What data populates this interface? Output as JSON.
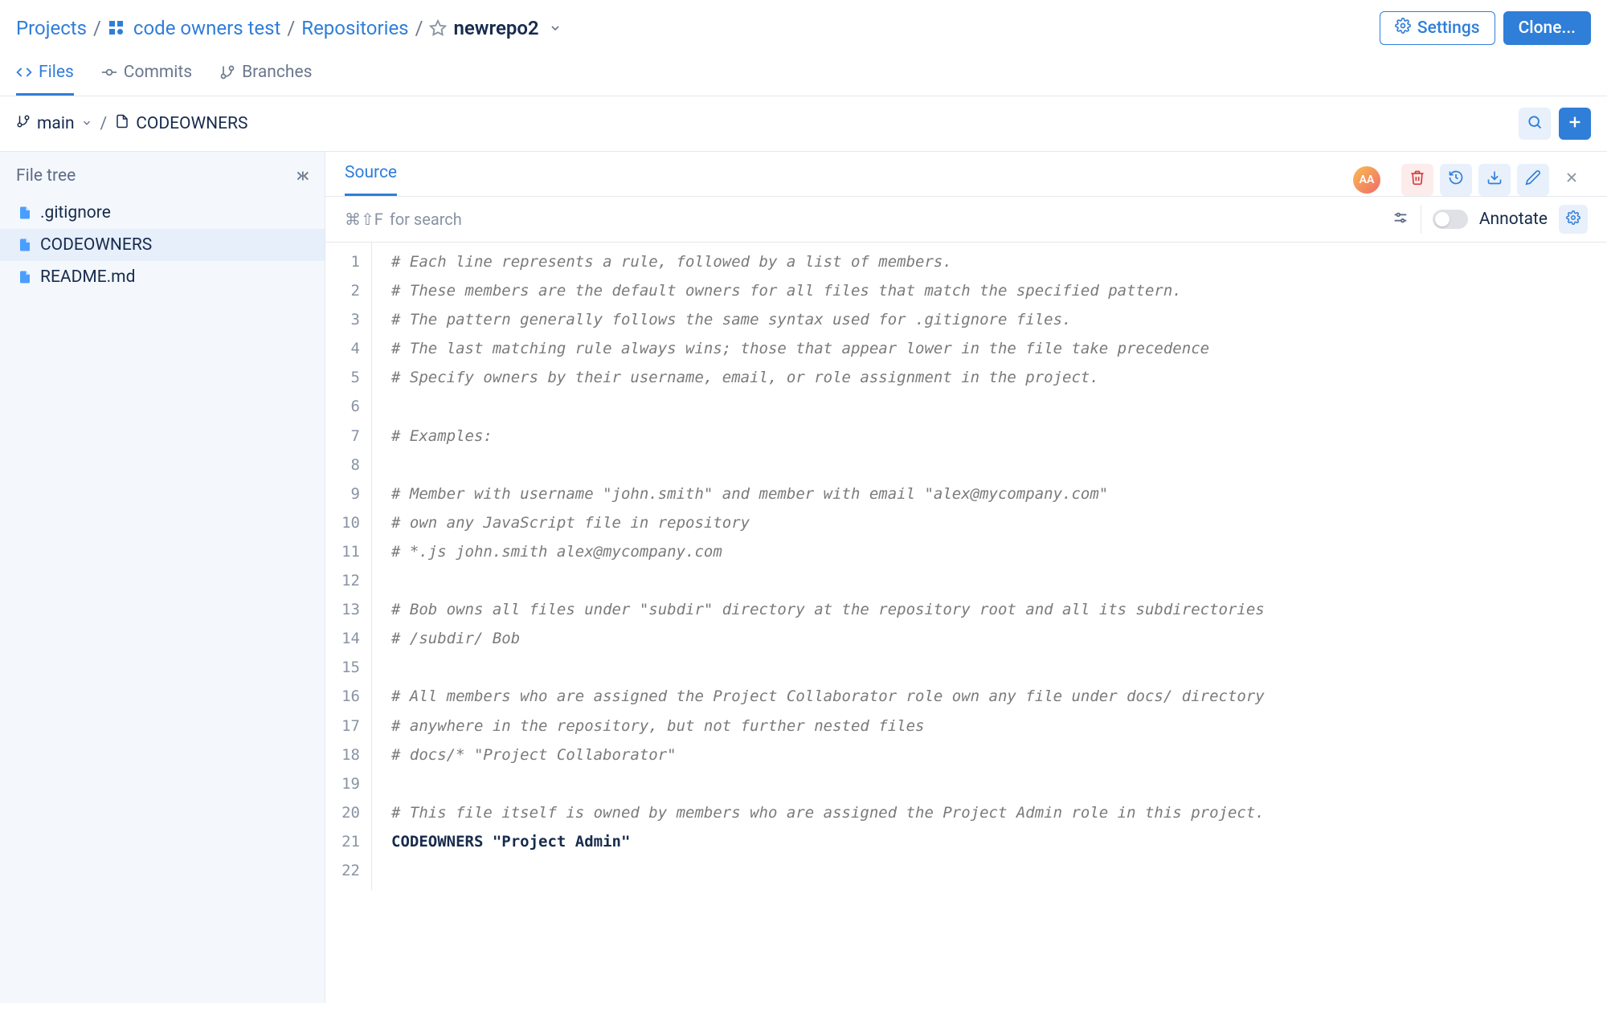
{
  "breadcrumb": {
    "projects": "Projects",
    "project_name": "code owners test",
    "repositories": "Repositories",
    "repo_name": "newrepo2"
  },
  "top_buttons": {
    "settings": "Settings",
    "clone": "Clone..."
  },
  "tabs": {
    "files": "Files",
    "commits": "Commits",
    "branches": "Branches"
  },
  "pathbar": {
    "branch": "main",
    "file": "CODEOWNERS"
  },
  "sidebar": {
    "title": "File tree",
    "items": [
      {
        "name": ".gitignore"
      },
      {
        "name": "CODEOWNERS"
      },
      {
        "name": "README.md"
      }
    ]
  },
  "content": {
    "tab_source": "Source",
    "avatar_initials": "AA",
    "search_hint_prefix": "⌘⇧F",
    "search_hint_suffix": " for search",
    "annotate": "Annotate"
  },
  "code_lines": [
    {
      "n": 1,
      "kind": "comment",
      "text": "# Each line represents a rule, followed by a list of members."
    },
    {
      "n": 2,
      "kind": "comment",
      "text": "# These members are the default owners for all files that match the specified pattern."
    },
    {
      "n": 3,
      "kind": "comment",
      "text": "# The pattern generally follows the same syntax used for .gitignore files."
    },
    {
      "n": 4,
      "kind": "comment",
      "text": "# The last matching rule always wins; those that appear lower in the file take precedence"
    },
    {
      "n": 5,
      "kind": "comment",
      "text": "# Specify owners by their username, email, or role assignment in the project."
    },
    {
      "n": 6,
      "kind": "blank",
      "text": ""
    },
    {
      "n": 7,
      "kind": "comment",
      "text": "# Examples:"
    },
    {
      "n": 8,
      "kind": "blank",
      "text": ""
    },
    {
      "n": 9,
      "kind": "comment",
      "text": "# Member with username \"john.smith\" and member with email \"alex@mycompany.com\""
    },
    {
      "n": 10,
      "kind": "comment",
      "text": "# own any JavaScript file in repository"
    },
    {
      "n": 11,
      "kind": "comment",
      "text": "# *.js john.smith alex@mycompany.com"
    },
    {
      "n": 12,
      "kind": "blank",
      "text": ""
    },
    {
      "n": 13,
      "kind": "comment",
      "text": "# Bob owns all files under \"subdir\" directory at the repository root and all its subdirectories"
    },
    {
      "n": 14,
      "kind": "comment",
      "text": "# /subdir/ Bob"
    },
    {
      "n": 15,
      "kind": "blank",
      "text": ""
    },
    {
      "n": 16,
      "kind": "comment",
      "text": "# All members who are assigned the Project Collaborator role own any file under docs/ directory"
    },
    {
      "n": 17,
      "kind": "comment",
      "text": "# anywhere in the repository, but not further nested files"
    },
    {
      "n": 18,
      "kind": "comment",
      "text": "# docs/* \"Project Collaborator\""
    },
    {
      "n": 19,
      "kind": "blank",
      "text": ""
    },
    {
      "n": 20,
      "kind": "comment",
      "text": "# This file itself is owned by members who are assigned the Project Admin role in this project."
    },
    {
      "n": 21,
      "kind": "code",
      "text": "CODEOWNERS \"Project Admin\""
    },
    {
      "n": 22,
      "kind": "blank",
      "text": ""
    }
  ]
}
